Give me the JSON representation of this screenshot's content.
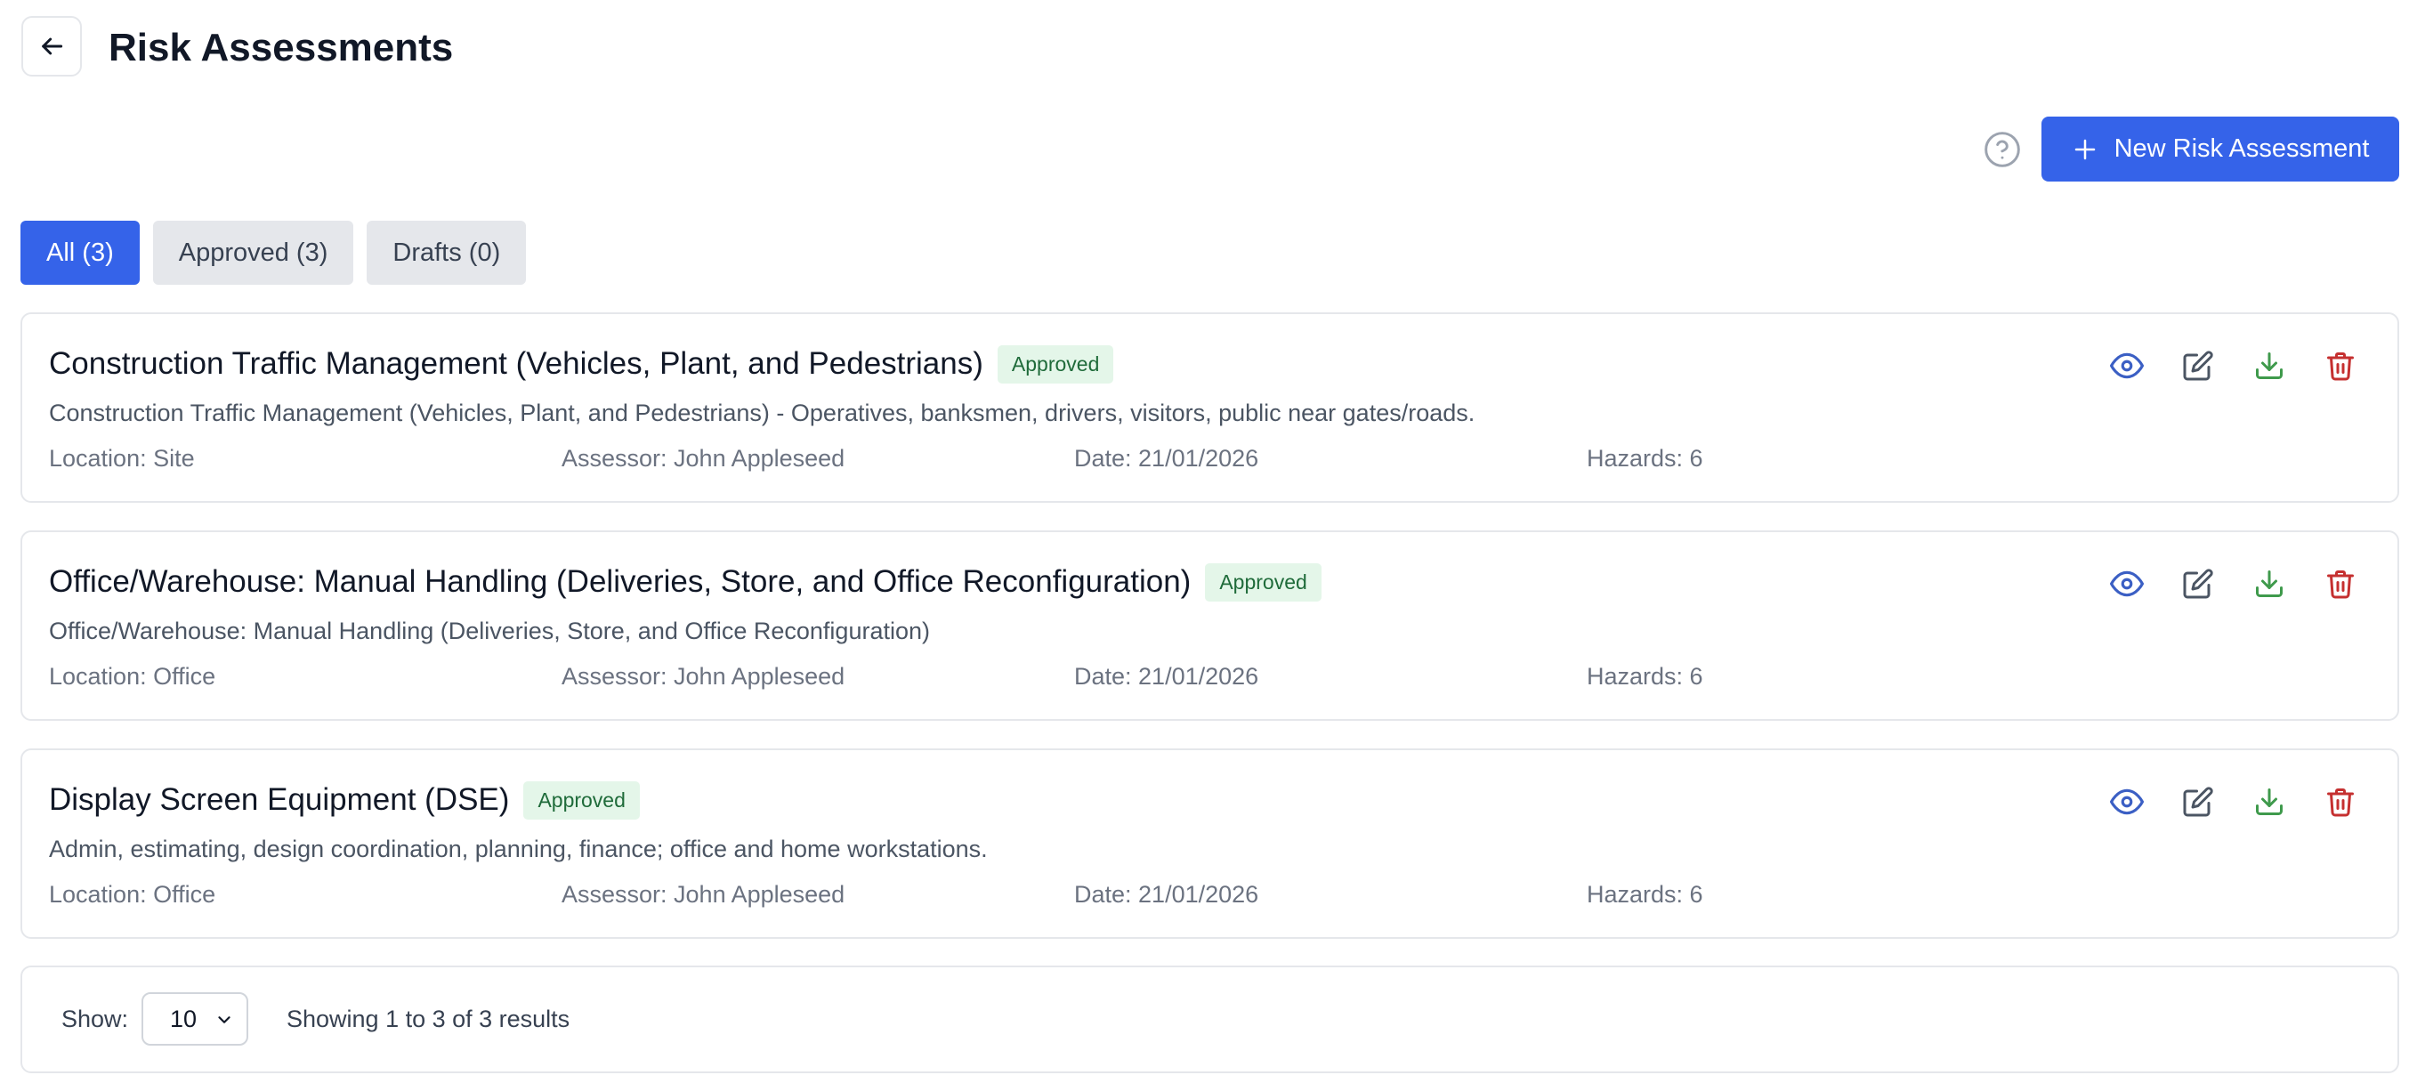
{
  "header": {
    "title": "Risk Assessments"
  },
  "toolbar": {
    "new_button_label": "New Risk Assessment"
  },
  "tabs": [
    {
      "label": "All (3)",
      "active": true
    },
    {
      "label": "Approved (3)",
      "active": false
    },
    {
      "label": "Drafts (0)",
      "active": false
    }
  ],
  "assessments": [
    {
      "title": "Construction Traffic Management (Vehicles, Plant, and Pedestrians)",
      "status": "Approved",
      "description": "Construction Traffic Management (Vehicles, Plant, and Pedestrians) - Operatives, banksmen, drivers, visitors, public near gates/roads.",
      "location": "Location: Site",
      "assessor": "Assessor: John Appleseed",
      "date": "Date: 21/01/2026",
      "hazards": "Hazards: 6"
    },
    {
      "title": "Office/Warehouse: Manual Handling (Deliveries, Store, and Office Reconfiguration)",
      "status": "Approved",
      "description": "Office/Warehouse: Manual Handling (Deliveries, Store, and Office Reconfiguration)",
      "location": "Location: Office",
      "assessor": "Assessor: John Appleseed",
      "date": "Date: 21/01/2026",
      "hazards": "Hazards: 6"
    },
    {
      "title": "Display Screen Equipment (DSE)",
      "status": "Approved",
      "description": "Admin, estimating, design coordination, planning, finance; office and home workstations.",
      "location": "Location: Office",
      "assessor": "Assessor: John Appleseed",
      "date": "Date: 21/01/2026",
      "hazards": "Hazards: 6"
    }
  ],
  "pagination": {
    "show_label": "Show:",
    "page_size": "10",
    "results_text": "Showing 1 to 3 of 3 results"
  },
  "icons": {
    "back": "arrow-left-icon",
    "help": "help-circle-icon",
    "add": "plus-icon",
    "view": "eye-icon",
    "edit": "edit-icon",
    "download": "download-icon",
    "delete": "trash-icon",
    "select": "chevron-down-icon"
  },
  "colors": {
    "primary": "#3563e9",
    "badge_bg": "#e4f6e9",
    "badge_text": "#1f6b3a",
    "view_icon": "#3b5fc4",
    "edit_icon": "#4b5563",
    "download_icon": "#3f9a4c",
    "delete_icon": "#c53030"
  }
}
